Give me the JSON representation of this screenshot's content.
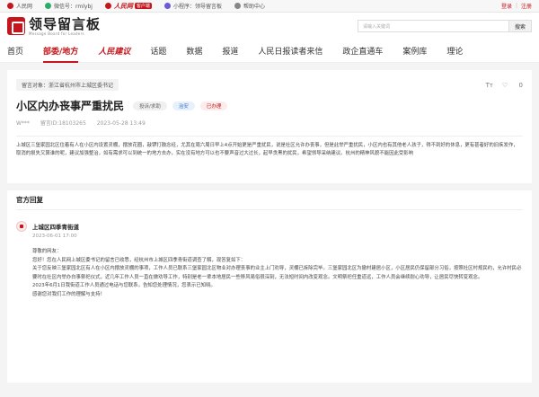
{
  "topbar": {
    "items": [
      {
        "label": "人民网",
        "color": "#c4161c"
      },
      {
        "label": "微信号：rmlybj",
        "color": "#2aae67"
      },
      {
        "label": "人民网",
        "color": "#c4161c",
        "badge": "客户端"
      },
      {
        "label": "小程序：领导留言板",
        "color": "#6b5bd6"
      },
      {
        "label": "帮助中心",
        "color": "#888888"
      }
    ],
    "login": "登录",
    "register": "注册"
  },
  "header": {
    "logo_cn": "领导留言板",
    "logo_en": "Message Board for Leaders",
    "search_placeholder": "请输入关键词",
    "search_button": "搜索"
  },
  "nav": {
    "items": [
      "首页",
      "部委/地方",
      "人民建议",
      "话题",
      "数据",
      "报道",
      "人民日报读者来信",
      "政企直通车",
      "案例库",
      "理论"
    ],
    "active_index": 1,
    "brand_index": 2
  },
  "message": {
    "object": "留言对象：浙江省杭州市上城区委书记",
    "font_tool": "Tт",
    "likes": "0",
    "title": "小区内办丧事严重扰民",
    "tags": [
      "投诉/求助",
      "治安",
      "已办理"
    ],
    "author": "W***",
    "id": "留言ID:18103265",
    "time": "2023-05-28 13:49",
    "content": "上城区三堡家园北区住着有人在小区内设置灵棚，摆放花圈，敲锣打鼓念经，尤其在周六周日早上4点开始更是严重扰民，说是社区允许办丧事，但是此举严重扰民，小区内也有其他老人孩子，得不到好的休息，更有甚者好的旧疾发作，取消的损失又算谁的呢，建议加强整治，如有需求可以到统一的地方去办，实在没有地方可以也不要声音过大过长，起早贪黑的扰民，希望领导采纳建议。杭州的精神风貌不能因此受影响"
  },
  "reply": {
    "section_title": "官方回复",
    "responder": "上城区四季青街道",
    "date": "2023-06-01 17:00",
    "paragraphs": [
      "尊敬的网友：",
      "您好！您在人民网上城区委书记的留言已收悉，经杭州市上城区四季青街道调查了解，现答复如下：",
      "关于您反映三堡家园北区有人在小区内摆放灵棚的事项，工作人员已联系三堡家园北区物业对办理丧事的业主上门劝导，灵棚已拆除完毕。三堡家园北区为撤村建居小区，小区居民仍保留部分习俗，按照社区村规民约，允许村民必要时在社区内举办白事祭祀仪式，近几年工作人员一直在做劝导工作，特别是老一辈本地居民一些移风易俗很深刻，无法短时间内改变观念。文明祭祀任重道远，工作人员会继续耐心劝导，让居民尽快转变观念。",
      "2023年6月1日我街道工作人员通过电话与您联系，告知您处理情况，您表示已知晓。",
      "感谢您对我们工作的理解与支持！"
    ]
  }
}
